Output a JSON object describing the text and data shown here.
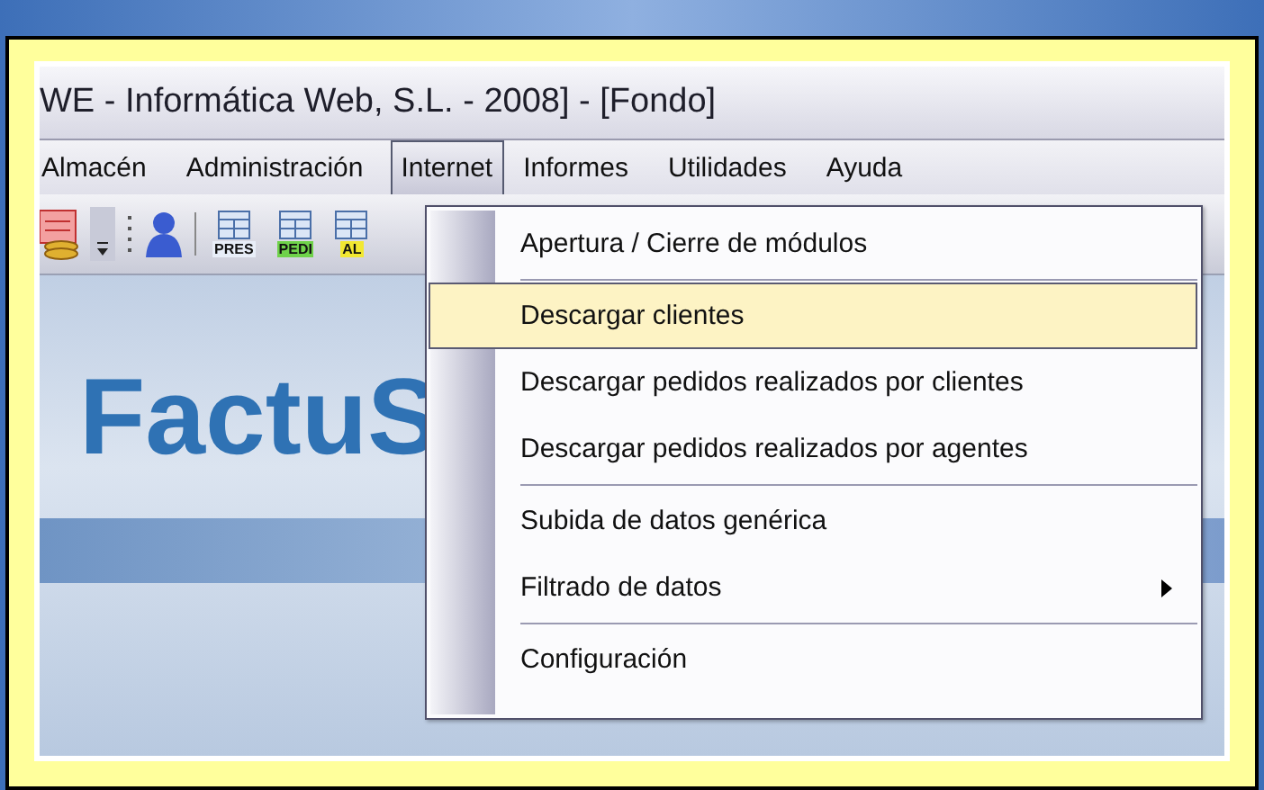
{
  "window": {
    "title": "WE - Informática Web, S.L. - 2008] - [Fondo]"
  },
  "menu_bar": [
    {
      "label": "Almacén",
      "selected": false
    },
    {
      "label": "Administración",
      "selected": false
    },
    {
      "label": "Internet",
      "selected": true
    },
    {
      "label": "Informes",
      "selected": false
    },
    {
      "label": "Utilidades",
      "selected": false
    },
    {
      "label": "Ayuda",
      "selected": false
    }
  ],
  "toolbar": {
    "doc_buttons": [
      {
        "label": "PRES",
        "color": "#e8eef8"
      },
      {
        "label": "PEDI",
        "color": "#6fd24a"
      },
      {
        "label": "AL",
        "color": "#f2e832"
      }
    ]
  },
  "logo": {
    "text": "FactuS"
  },
  "menu": {
    "items": [
      {
        "kind": "item",
        "label": "Apertura / Cierre de módulos",
        "selected": false,
        "submenu": false
      },
      {
        "kind": "separator"
      },
      {
        "kind": "item",
        "label": "Descargar clientes",
        "selected": true,
        "submenu": false
      },
      {
        "kind": "item",
        "label": "Descargar pedidos realizados por clientes",
        "selected": false,
        "submenu": false
      },
      {
        "kind": "item",
        "label": "Descargar pedidos realizados por agentes",
        "selected": false,
        "submenu": false
      },
      {
        "kind": "separator"
      },
      {
        "kind": "item",
        "label": "Subida de datos genérica",
        "selected": false,
        "submenu": false
      },
      {
        "kind": "item",
        "label": "Filtrado de datos",
        "selected": false,
        "submenu": true
      },
      {
        "kind": "separator"
      },
      {
        "kind": "item",
        "label": "Configuración",
        "selected": false,
        "submenu": false
      }
    ]
  }
}
